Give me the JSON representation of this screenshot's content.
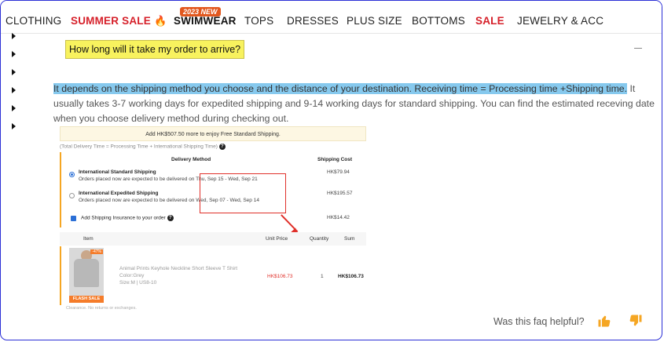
{
  "nav": {
    "items": [
      "CLOTHING",
      "SUMMER SALE",
      "SWIMWEAR",
      "TOPS",
      "DRESSES",
      "PLUS SIZE",
      "BOTTOMS",
      "SALE",
      "JEWELRY & ACC"
    ],
    "badge": "2023 NEW",
    "flame_icon": "fire-icon"
  },
  "faq": {
    "question": "How long will it take my order to arrive?",
    "answer_highlight": "It depends on the shipping method you choose and the distance of your destination. Receiving time = Processing time +Shipping time.",
    "answer_rest": " It usually takes 3-7 working days for expedited shipping and 9-14 working days for standard shipping. You can find the estimated receving date when you choose delivery method during checking out."
  },
  "checkout": {
    "free_shipping": "Add HK$507.50 more to enjoy Free Standard Shipping.",
    "delivery_note": "(Total Delivery Time = Processing Time + International Shipping Time)",
    "delivery_method_header": "Delivery Method",
    "shipping_cost_header": "Shipping Cost",
    "options": [
      {
        "title": "International Standard Shipping",
        "subtitle": "Orders placed now are expected to be delivered on Thu, Sep 15 - Wed, Sep 21",
        "price": "HK$79.94",
        "selected": true
      },
      {
        "title": "International Expedited Shipping",
        "subtitle": "Orders placed now are expected to be delivered on Wed, Sep 07 - Wed, Sep 14",
        "price": "HK$195.57",
        "selected": false
      }
    ],
    "insurance_label": "Add Shipping Insurance to your order",
    "insurance_price": "HK$14.42",
    "items_headers": [
      "Item",
      "Unit Price",
      "Quantity",
      "Sum"
    ],
    "item": {
      "discount": "-47%",
      "flash": "FLASH SALE",
      "name": "Animal Prints Keyhole Neckline Short Sleeve T Shirt",
      "color": "Color:Grey",
      "size": "Size:M | US8-10",
      "unit_price": "HK$106.73",
      "quantity": "1",
      "sum": "HK$106.73"
    },
    "clearance": "Clearance. No returns or exchanges."
  },
  "feedback": {
    "prompt": "Was this faq helpful?",
    "thumbs_up_icon": "thumbs-up-icon",
    "thumbs_down_icon": "thumbs-down-icon",
    "accent": "#f5a623"
  }
}
